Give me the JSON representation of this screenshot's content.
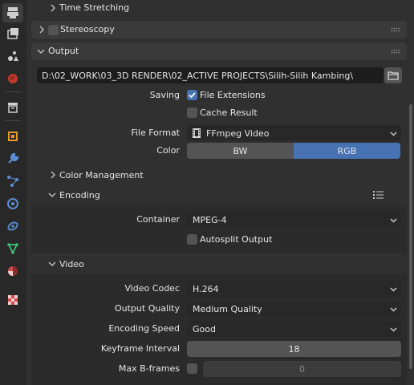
{
  "sidebar": {
    "tabs": [
      {
        "icon": "output-icon",
        "active": true
      },
      {
        "icon": "view-layer-icon"
      },
      {
        "icon": "scene-icon"
      },
      {
        "icon": "world-icon"
      },
      {
        "icon": "collection-icon"
      },
      {
        "icon": "object-icon"
      },
      {
        "icon": "modifier-wrench-icon"
      },
      {
        "icon": "particles-icon"
      },
      {
        "icon": "physics-icon"
      },
      {
        "icon": "constraints-icon"
      },
      {
        "icon": "object-data-icon"
      },
      {
        "icon": "material-icon"
      },
      {
        "icon": "texture-icon"
      }
    ]
  },
  "sections": {
    "time_stretching": "Time Stretching",
    "stereoscopy": "Stereoscopy",
    "output": "Output",
    "color_management": "Color Management",
    "encoding": "Encoding",
    "video": "Video"
  },
  "output": {
    "path": "D:\\02_WORK\\03_3D RENDER\\02_ACTIVE PROJECTS\\Silih-Silih Kambing\\",
    "saving_label": "Saving",
    "file_extensions": {
      "label": "File Extensions",
      "checked": true
    },
    "cache_result": {
      "label": "Cache Result",
      "checked": false
    },
    "file_format_label": "File Format",
    "file_format_value": "FFmpeg Video",
    "color_label": "Color",
    "color_options": [
      "BW",
      "RGB"
    ],
    "color_selected": "RGB"
  },
  "encoding": {
    "container_label": "Container",
    "container_value": "MPEG-4",
    "autosplit": {
      "label": "Autosplit Output",
      "checked": false
    }
  },
  "video": {
    "codec_label": "Video Codec",
    "codec_value": "H.264",
    "quality_label": "Output Quality",
    "quality_value": "Medium Quality",
    "speed_label": "Encoding Speed",
    "speed_value": "Good",
    "keyframe_label": "Keyframe Interval",
    "keyframe_value": "18",
    "bframes_label": "Max B-frames",
    "bframes_enabled": false,
    "bframes_value": "0"
  },
  "colors": {
    "accent": "#4772b3",
    "panel_bg": "#303030",
    "header_bg": "#3a3a3a",
    "sidebar_bg": "#282828"
  }
}
